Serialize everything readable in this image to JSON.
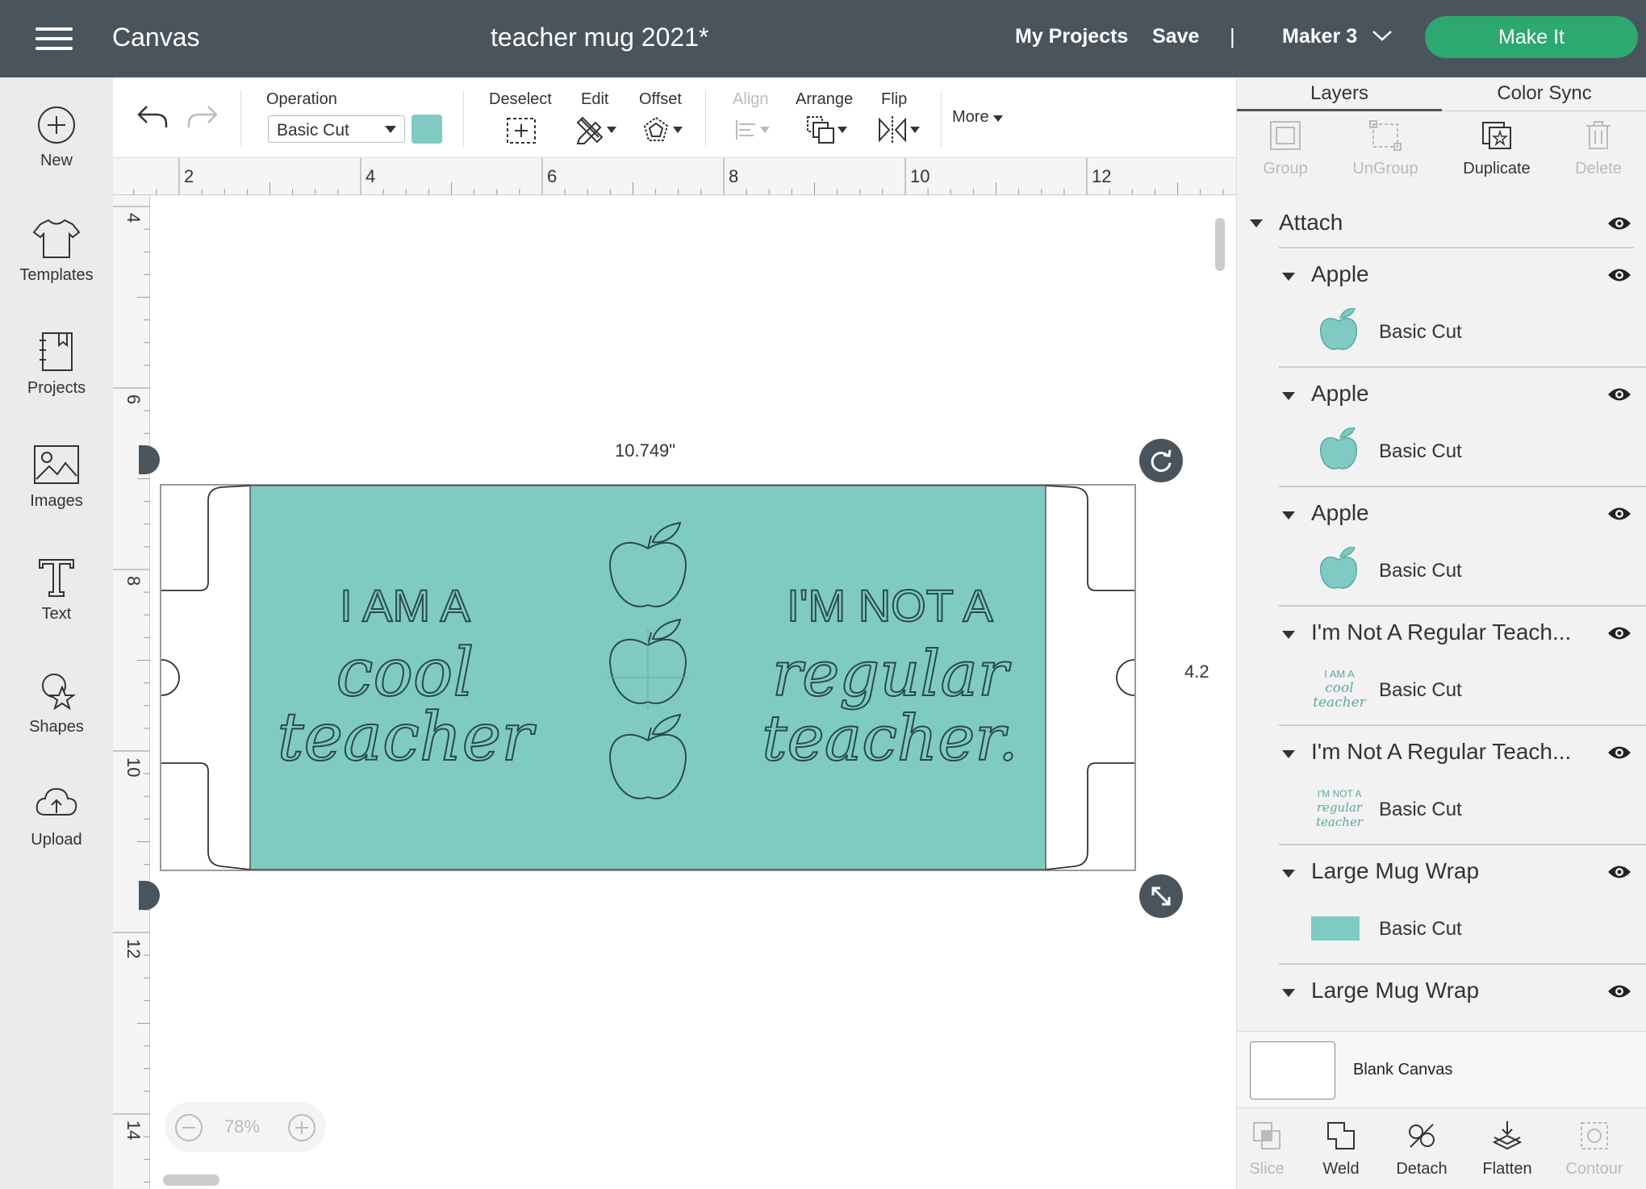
{
  "header": {
    "app_title": "Canvas",
    "doc_title": "teacher mug 2021*",
    "my_projects": "My Projects",
    "save": "Save",
    "separator": "|",
    "machine": "Maker 3",
    "make_it": "Make It",
    "make_it_color": "#2da86f",
    "bar_color": "#4a545c"
  },
  "sidebar": {
    "items": [
      {
        "label": "New",
        "icon": "plus-circle-icon"
      },
      {
        "label": "Templates",
        "icon": "tshirt-icon"
      },
      {
        "label": "Projects",
        "icon": "notebook-icon"
      },
      {
        "label": "Images",
        "icon": "image-icon"
      },
      {
        "label": "Text",
        "icon": "text-t-icon"
      },
      {
        "label": "Shapes",
        "icon": "shapes-icon"
      },
      {
        "label": "Upload",
        "icon": "cloud-upload-icon"
      }
    ]
  },
  "toolbar": {
    "operation_label": "Operation",
    "operation_value": "Basic Cut",
    "operation_color": "#7fcbc4",
    "deselect": "Deselect",
    "edit": "Edit",
    "offset": "Offset",
    "align": "Align",
    "arrange": "Arrange",
    "flip": "Flip",
    "more": "More"
  },
  "rulers": {
    "horizontal": [
      "2",
      "4",
      "6",
      "8",
      "10",
      "12"
    ],
    "vertical": [
      "4",
      "6",
      "8",
      "10",
      "12",
      "14"
    ]
  },
  "canvas": {
    "width_label": "10.749\"",
    "height_label": "4.2",
    "zoom": "78%",
    "wrap_color": "#7fcbc4",
    "left_text": {
      "line1": "I AM A",
      "line2": "cool",
      "line3": "teacher"
    },
    "right_text": {
      "line1": "I'M NOT A",
      "line2": "regular",
      "line3": "teacher."
    }
  },
  "right_panel": {
    "tabs": [
      "Layers",
      "Color Sync"
    ],
    "tools": [
      {
        "label": "Group",
        "enabled": false
      },
      {
        "label": "UnGroup",
        "enabled": false
      },
      {
        "label": "Duplicate",
        "enabled": true
      },
      {
        "label": "Delete",
        "enabled": false
      }
    ],
    "root_layer": "Attach",
    "layers": [
      {
        "name": "Apple",
        "op": "Basic Cut",
        "thumb": "apple"
      },
      {
        "name": "Apple",
        "op": "Basic Cut",
        "thumb": "apple"
      },
      {
        "name": "Apple",
        "op": "Basic Cut",
        "thumb": "apple"
      },
      {
        "name": "I'm Not A Regular Teach...",
        "op": "Basic Cut",
        "thumb": "text1",
        "thumb_text": "I AM A cool teacher"
      },
      {
        "name": "I'm Not A Regular Teach...",
        "op": "Basic Cut",
        "thumb": "text2",
        "thumb_text": "I'M NOT A regular teacher"
      },
      {
        "name": "Large Mug Wrap",
        "op": "Basic Cut",
        "thumb": "swatch"
      },
      {
        "name": "Large Mug Wrap",
        "op": "",
        "thumb": "none"
      }
    ],
    "blank_canvas": "Blank Canvas",
    "bottom_tools": [
      {
        "label": "Slice",
        "enabled": false
      },
      {
        "label": "Weld",
        "enabled": true
      },
      {
        "label": "Detach",
        "enabled": true
      },
      {
        "label": "Flatten",
        "enabled": true
      },
      {
        "label": "Contour",
        "enabled": false
      }
    ]
  }
}
